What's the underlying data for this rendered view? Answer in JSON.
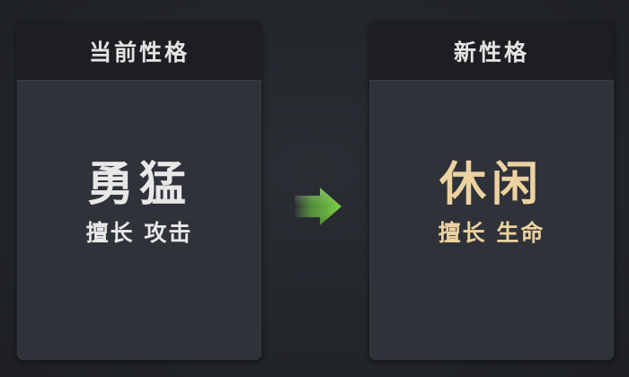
{
  "current_personality": {
    "header": "当前性格",
    "name": "勇猛",
    "specialty": "擅长 攻击"
  },
  "new_personality": {
    "header": "新性格",
    "name": "休闲",
    "specialty": "擅长 生命"
  },
  "arrow_icon": "arrow-right-icon",
  "colors": {
    "current_text": "#e8e8e8",
    "new_text": "#ecd2a0",
    "arrow": "#6cc33a"
  }
}
